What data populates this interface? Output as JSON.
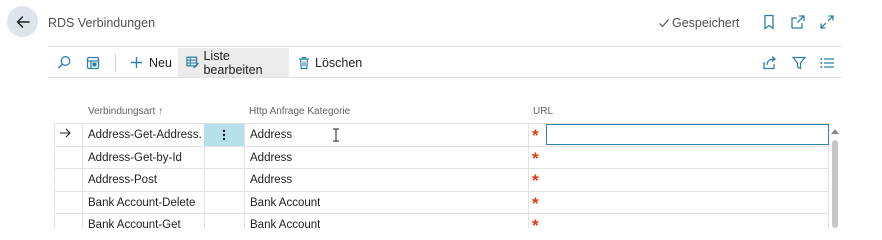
{
  "header": {
    "title": "RDS Verbindungen",
    "status": "Gespeichert"
  },
  "toolbar": {
    "new_label": "Neu",
    "edit_list_label": "Liste bearbeiten",
    "delete_label": "Löschen"
  },
  "grid": {
    "columns": [
      "Verbindungsart",
      "Http Anfrage Kategorie",
      "URL"
    ],
    "sort_indicator": "↑",
    "required_marker": "*",
    "rows": [
      {
        "type": "Address-Get-Address...",
        "category": "Address"
      },
      {
        "type": "Address-Get-by-Id",
        "category": "Address"
      },
      {
        "type": "Address-Post",
        "category": "Address"
      },
      {
        "type": "Bank Account-Delete",
        "category": "Bank Account"
      },
      {
        "type": "Bank Account-Get",
        "category": "Bank Account"
      }
    ]
  },
  "colors": {
    "accent": "#2e80a8",
    "selected_cell": "#b6e0ec",
    "required_star": "#e03c16",
    "back_button_bg": "#dde4eb"
  }
}
